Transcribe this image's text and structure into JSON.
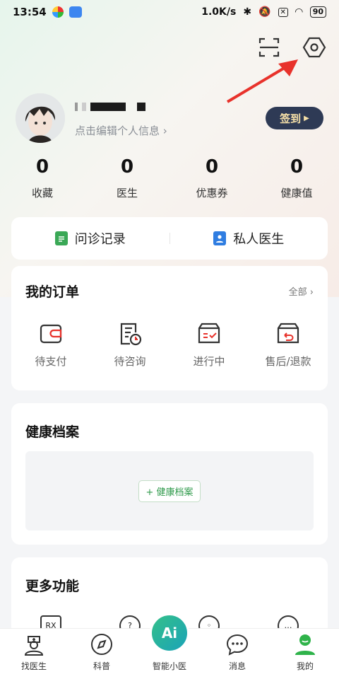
{
  "status_bar": {
    "time": "13:54",
    "network_speed": "1.0K/s",
    "battery": "90"
  },
  "profile": {
    "edit_link": "点击编辑个人信息",
    "signin_button": "签到"
  },
  "stats": [
    {
      "value": "0",
      "label": "收藏"
    },
    {
      "value": "0",
      "label": "医生"
    },
    {
      "value": "0",
      "label": "优惠券"
    },
    {
      "value": "0",
      "label": "健康值"
    }
  ],
  "quick_links": [
    {
      "label": "问诊记录",
      "icon": "calendar-icon",
      "color": "#3aa856"
    },
    {
      "label": "私人医生",
      "icon": "doctor-badge-icon",
      "color": "#2f7de1"
    }
  ],
  "orders": {
    "title": "我的订单",
    "all_link": "全部",
    "items": [
      {
        "label": "待支付",
        "icon": "wallet-icon"
      },
      {
        "label": "待咨询",
        "icon": "document-clock-icon"
      },
      {
        "label": "进行中",
        "icon": "box-check-icon"
      },
      {
        "label": "售后/退款",
        "icon": "box-return-icon"
      }
    ]
  },
  "health_records": {
    "title": "健康档案",
    "add_button": "+ 健康档案"
  },
  "more_features": {
    "title": "更多功能",
    "first_icon_text": "RX"
  },
  "tab_bar": [
    {
      "label": "找医生",
      "icon": "doctor-icon"
    },
    {
      "label": "科普",
      "icon": "compass-icon"
    },
    {
      "label": "智能小医",
      "icon": "ai-icon",
      "badge_text": "Ai"
    },
    {
      "label": "消息",
      "icon": "chat-icon"
    },
    {
      "label": "我的",
      "icon": "profile-icon",
      "active": true
    }
  ],
  "colors": {
    "accent_green": "#2f9a4b",
    "signin_bg": "#2e3a55",
    "arrow_red": "#e8322b"
  }
}
